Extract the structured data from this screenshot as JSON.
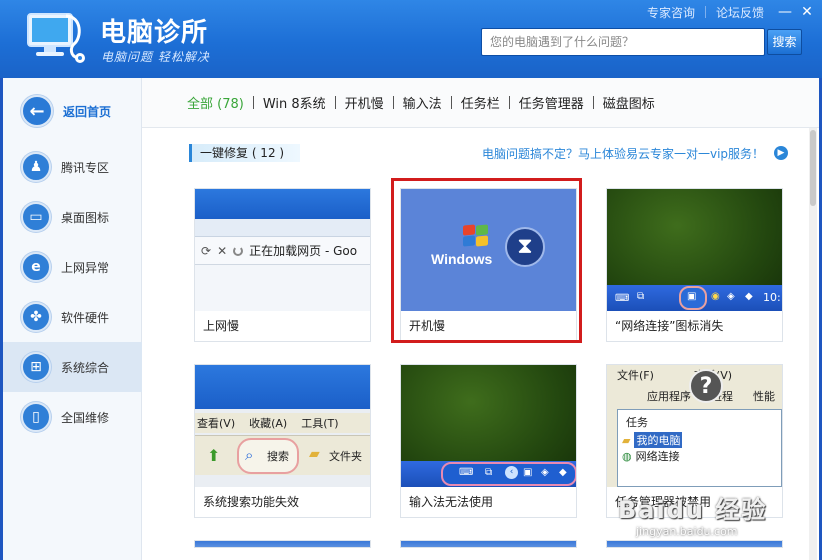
{
  "header": {
    "app_title": "电脑诊所",
    "app_subtitle": "电脑问题 轻松解决",
    "links": [
      "专家咨询",
      "论坛反馈"
    ],
    "search_placeholder": "您的电脑遇到了什么问题？",
    "search_button": "搜索"
  },
  "sidebar": {
    "back_label": "返回首页",
    "items": [
      {
        "label": "腾讯专区",
        "icon": "penguin-icon"
      },
      {
        "label": "桌面图标",
        "icon": "monitor-icon"
      },
      {
        "label": "上网异常",
        "icon": "ie-icon"
      },
      {
        "label": "软件硬件",
        "icon": "puzzle-icon"
      },
      {
        "label": "系统综合",
        "icon": "windows-icon",
        "active": true
      },
      {
        "label": "全国维修",
        "icon": "phone-icon"
      }
    ]
  },
  "tabs": [
    "全部 (78)",
    "Win 8系统",
    "开机慢",
    "输入法",
    "任务栏",
    "任务管理器",
    "磁盘图标"
  ],
  "section": {
    "title": "一键修复 ( 12 )",
    "promo": "电脑问题搞不定？马上体验易云专家一对一vip服务！"
  },
  "cards": [
    {
      "caption": "上网慢",
      "thumb_text": "正在加载网页 - Goo"
    },
    {
      "caption": "开机慢",
      "thumb_text": "Windows"
    },
    {
      "caption": "“网络连接”图标消失",
      "thumb_text": "10:"
    },
    {
      "caption": "系统搜索功能失效",
      "thumb_text": [
        "查看(V)",
        "收藏(A)",
        "工具(T)",
        "搜索",
        "文件夹"
      ]
    },
    {
      "caption": "输入法无法使用",
      "thumb_text": ""
    },
    {
      "caption": "任务管理器被禁用",
      "thumb_text": [
        "文件(F)",
        "查看(V)",
        "应用程序",
        "进程",
        "性能",
        "任务",
        "我的电脑",
        "网络连接"
      ]
    }
  ],
  "watermark": {
    "text": "Baidu 经验",
    "url": "jingyan.baidu.com"
  },
  "colors": {
    "accent": "#1b6fd3",
    "active_tab": "#3aa63a",
    "highlight": "#d21c1c"
  }
}
